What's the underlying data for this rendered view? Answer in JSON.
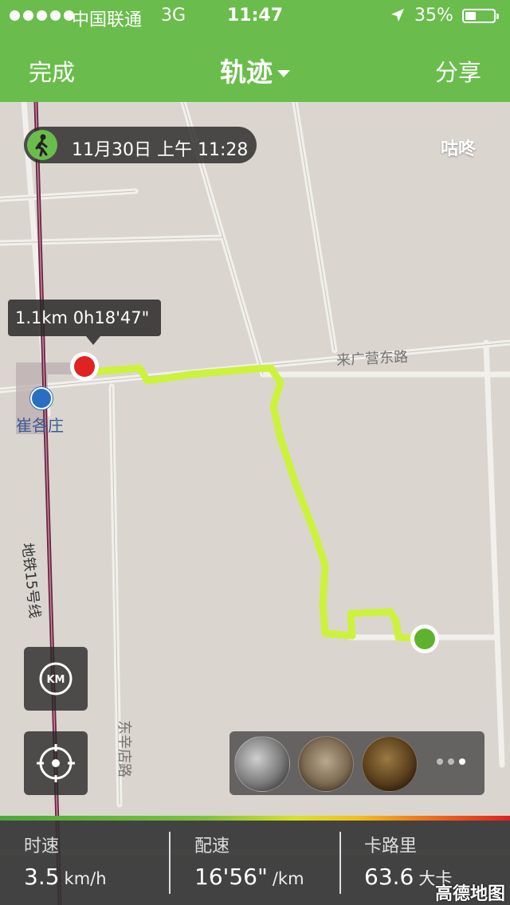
{
  "status_bar": {
    "carrier": "中国联通",
    "network": "3G",
    "time": "11:47",
    "battery_percent_text": "35%",
    "battery_level": 0.35,
    "location_icon": "location-arrow-icon"
  },
  "nav": {
    "left": "完成",
    "title": "轨迹",
    "right": "分享"
  },
  "track": {
    "date_text": "11月30日 上午 11:28",
    "user_name": "咕咚",
    "callout": "1.1km 0h18'47\"",
    "start_marker_color": "#e02222",
    "end_marker_color": "#5fb22b",
    "route_color": "#ccf23c"
  },
  "map": {
    "road_east": "来广营东路",
    "road_south": "东辛店路",
    "station": "崔各庄",
    "metro_line": "地铁15号线"
  },
  "controls": {
    "km_button": "KM",
    "locate_button": "locate-icon"
  },
  "photos": {
    "count_visible": 3,
    "page_dots": 3,
    "active_dot": 3
  },
  "stats": {
    "speed": {
      "label": "时速",
      "value": "3.5",
      "unit": "km/h"
    },
    "pace": {
      "label": "配速",
      "value": "16'56\"",
      "unit": "/km"
    },
    "calories": {
      "label": "卡路里",
      "value": "63.6",
      "unit": "大卡"
    }
  },
  "watermark": "高德地图",
  "colors": {
    "brand_green": "#6abd4c",
    "panel_dark": "#323232"
  }
}
